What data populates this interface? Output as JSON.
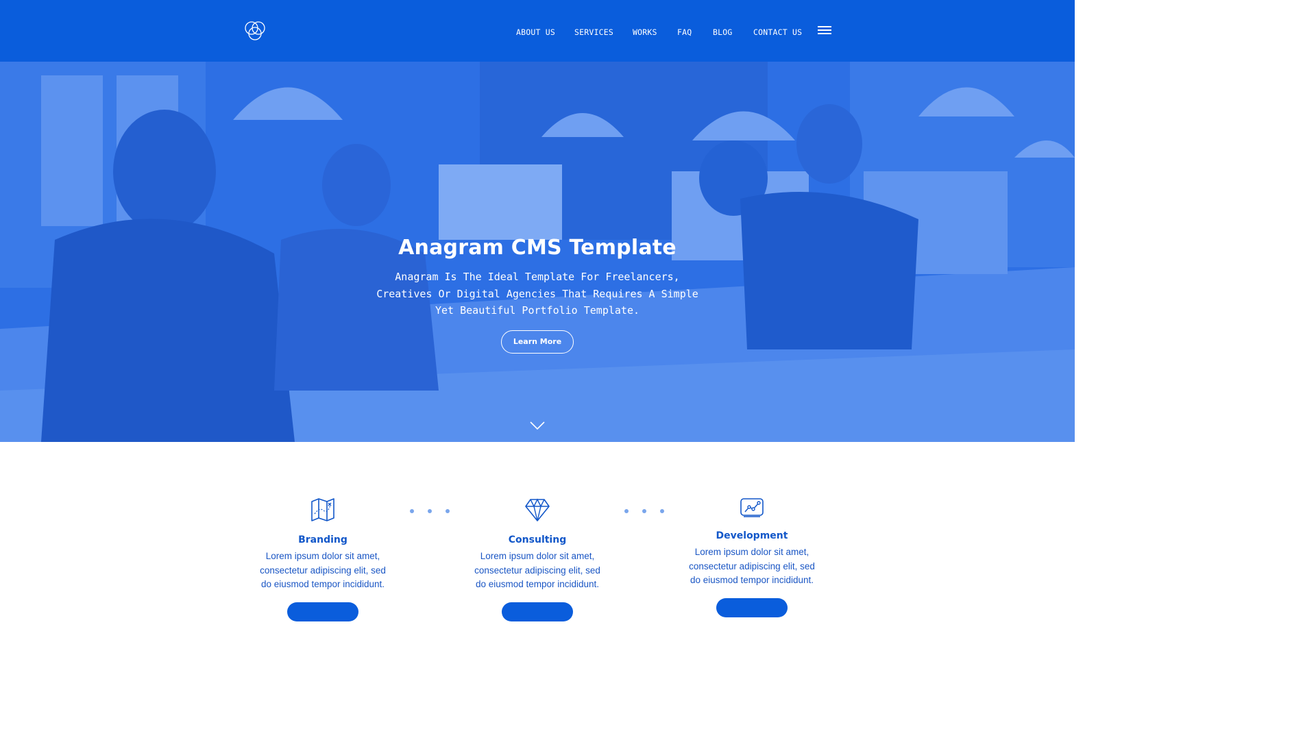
{
  "nav": {
    "logo": "logo-icon",
    "items": [
      {
        "label": "ABOUT US"
      },
      {
        "label": "SERVICES"
      },
      {
        "label": "WORKS"
      },
      {
        "label": "FAQ"
      },
      {
        "label": "BLOG"
      },
      {
        "label": "CONTACT US"
      }
    ],
    "menu_icon": "hamburger-icon"
  },
  "hero": {
    "title": "Anagram CMS Template",
    "subtitle": "Anagram Is The Ideal Template For Freelancers, Creatives Or Digital Agencies That Requires A Simple Yet Beautiful Portfolio Template.",
    "button_label": "Learn More",
    "scroll_icon": "chevron-down-icon"
  },
  "services": [
    {
      "title": "Branding",
      "description": "Lorem ipsum dolor sit amet, consectetur adipiscing elit, sed do eiusmod tempor incididunt.",
      "icon": "map-icon"
    },
    {
      "title": "Consulting",
      "description": "Lorem ipsum dolor sit amet, consectetur adipiscing elit, sed do eiusmod tempor incididunt.",
      "icon": "diamond-icon"
    },
    {
      "title": "Development",
      "description": "Lorem ipsum dolor sit amet, consectetur adipiscing elit, sed do eiusmod tempor incididunt.",
      "icon": "chart-board-icon"
    }
  ],
  "colors": {
    "brand_blue": "#0a5ddc",
    "hero_overlay": "#2d6fe4",
    "service_text": "#1257c9",
    "dot": "#7aa6ec"
  }
}
